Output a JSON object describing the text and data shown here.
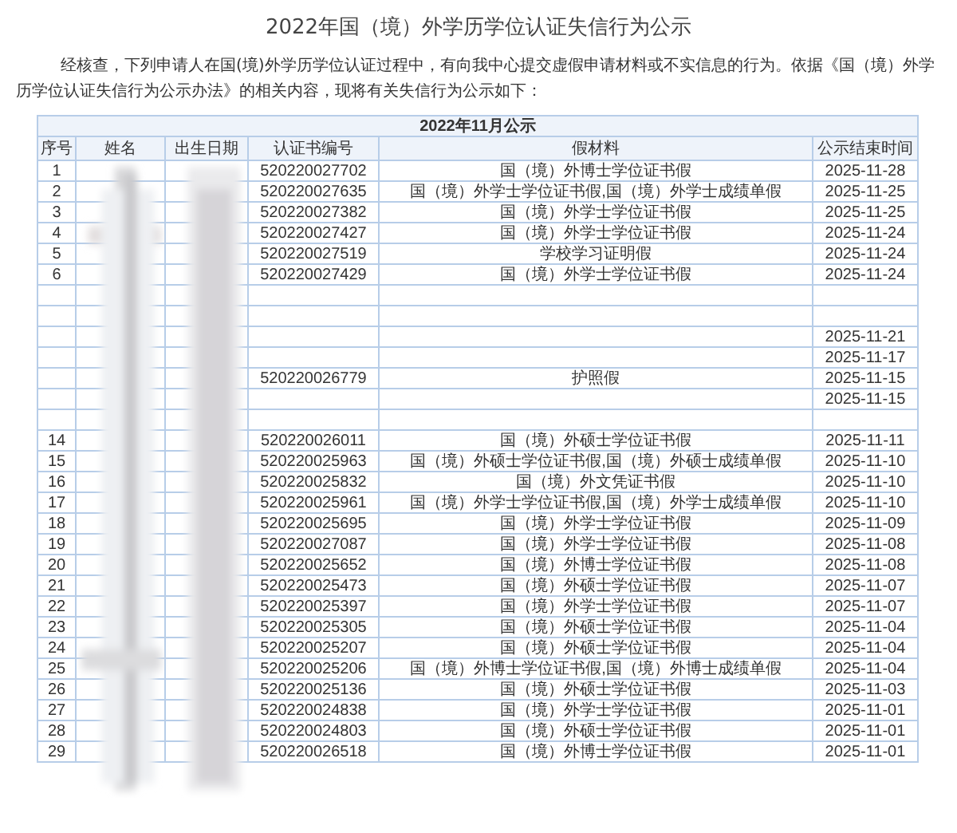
{
  "title": "2022年国（境）外学历学位认证失信行为公示",
  "intro": "经核查，下列申请人在国(境)外学历学位认证过程中，有向我中心提交虚假申请材料或不实信息的行为。依据《国（境）外学历学位认证失信行为公示办法》的相关内容，现将有关失信行为公示如下：",
  "table": {
    "caption": "2022年11月公示",
    "columns": [
      "序号",
      "姓名",
      "出生日期",
      "认证书编号",
      "假材料",
      "公示结束时间"
    ],
    "rows": [
      {
        "no": "1",
        "cert": "520220027702",
        "material": "国（境）外博士学位证书假",
        "date": "2025-11-28"
      },
      {
        "no": "2",
        "cert": "520220027635",
        "material": "国（境）外学士学位证书假,国（境）外学士成绩单假",
        "date": "2025-11-25"
      },
      {
        "no": "3",
        "cert": "520220027382",
        "material": "国（境）外学士学位证书假",
        "date": "2025-11-25"
      },
      {
        "no": "4",
        "cert": "520220027427",
        "material": "国（境）外学士学位证书假",
        "date": "2025-11-24"
      },
      {
        "no": "5",
        "cert": "520220027519",
        "material": "学校学习证明假",
        "date": "2025-11-24"
      },
      {
        "no": "6",
        "cert": "520220027429",
        "material": "国（境）外学士学位证书假",
        "date": "2025-11-24"
      },
      {},
      {},
      {
        "date": "2025-11-21"
      },
      {
        "date": "2025-11-17"
      },
      {
        "cert": "520220026779",
        "material": "护照假",
        "date": "2025-11-15"
      },
      {
        "date": "2025-11-15"
      },
      {},
      {
        "no": "14",
        "cert": "520220026011",
        "material": "国（境）外硕士学位证书假",
        "date": "2025-11-11"
      },
      {
        "no": "15",
        "cert": "520220025963",
        "material": "国（境）外硕士学位证书假,国（境）外硕士成绩单假",
        "date": "2025-11-10"
      },
      {
        "no": "16",
        "cert": "520220025832",
        "material": "国（境）外文凭证书假",
        "date": "2025-11-10"
      },
      {
        "no": "17",
        "cert": "520220025961",
        "material": "国（境）外学士学位证书假,国（境）外学士成绩单假",
        "date": "2025-11-10"
      },
      {
        "no": "18",
        "cert": "520220025695",
        "material": "国（境）外学士学位证书假",
        "date": "2025-11-09"
      },
      {
        "no": "19",
        "cert": "520220027087",
        "material": "国（境）外学士学位证书假",
        "date": "2025-11-08"
      },
      {
        "no": "20",
        "cert": "520220025652",
        "material": "国（境）外博士学位证书假",
        "date": "2025-11-08"
      },
      {
        "no": "21",
        "cert": "520220025473",
        "material": "国（境）外硕士学位证书假",
        "date": "2025-11-07"
      },
      {
        "no": "22",
        "cert": "520220025397",
        "material": "国（境）外学士学位证书假",
        "date": "2025-11-07"
      },
      {
        "no": "23",
        "cert": "520220025305",
        "material": "国（境）外硕士学位证书假",
        "date": "2025-11-04"
      },
      {
        "no": "24",
        "cert": "520220025207",
        "material": "国（境）外硕士学位证书假",
        "date": "2025-11-04"
      },
      {
        "no": "25",
        "cert": "520220025206",
        "material": "国（境）外博士学位证书假,国（境）外博士成绩单假",
        "date": "2025-11-04"
      },
      {
        "no": "26",
        "cert": "520220025136",
        "material": "国（境）外硕士学位证书假",
        "date": "2025-11-03"
      },
      {
        "no": "27",
        "cert": "520220024838",
        "material": "国（境）外学士学位证书假",
        "date": "2025-11-01"
      },
      {
        "no": "28",
        "cert": "520220024803",
        "material": "国（境）外硕士学位证书假",
        "date": "2025-11-01"
      },
      {
        "no": "29",
        "cert": "520220026518",
        "material": "国（境）外博士学位证书假",
        "date": "2025-11-01"
      }
    ]
  }
}
